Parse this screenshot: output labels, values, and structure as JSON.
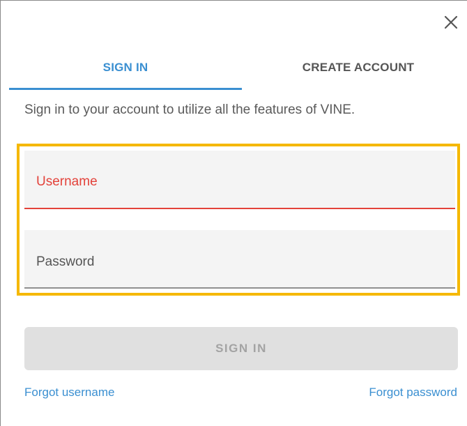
{
  "tabs": [
    {
      "label": "SIGN IN",
      "active": true
    },
    {
      "label": "CREATE ACCOUNT",
      "active": false
    }
  ],
  "intro_text": "Sign in to your account to utilize all the features of VINE.",
  "form": {
    "username": {
      "label": "Username",
      "value": ""
    },
    "password": {
      "label": "Password",
      "value": ""
    }
  },
  "submit_label": "SIGN IN",
  "links": {
    "forgot_username": "Forgot username",
    "forgot_password": "Forgot password"
  },
  "icons": {
    "close": "close-icon"
  },
  "colors": {
    "accent": "#3a8fd1",
    "error": "#e3423a",
    "highlight": "#f5b800",
    "disabled_button": "#e0e0e0"
  }
}
